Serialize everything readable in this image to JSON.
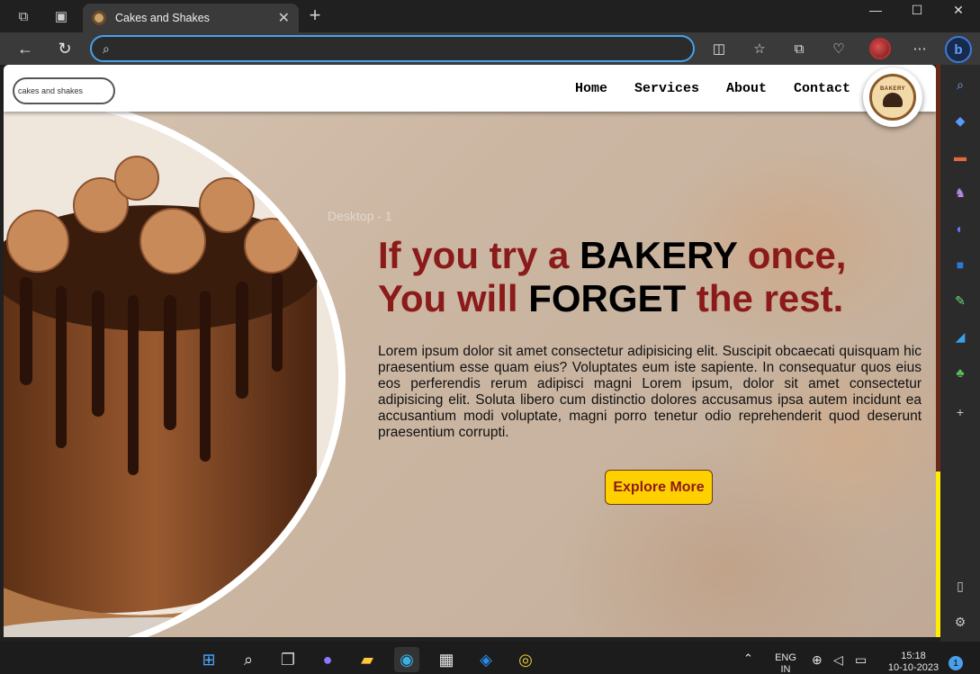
{
  "browser": {
    "tab_title": "Cakes and Shakes",
    "address_value": "",
    "window_controls": [
      "minimize-icon",
      "maximize-icon",
      "close-icon"
    ],
    "toolbar_icons": [
      "split-screen-icon",
      "favorites-icon",
      "collections-icon",
      "health-icon",
      "profile-avatar",
      "more-icon",
      "bing-icon"
    ],
    "sidebar_icons": [
      "search-icon",
      "shopping-icon",
      "tools-icon",
      "games-icon",
      "copilot-icon",
      "outlook-icon",
      "designer-icon",
      "drop-icon",
      "tree-icon",
      "add-icon",
      "panel-icon",
      "settings-icon"
    ]
  },
  "site": {
    "search_value": "cakes and shakes",
    "nav": [
      "Home",
      "Services",
      "About",
      "Contact"
    ],
    "logo_text": "BAKERY",
    "headline": {
      "line1_a": "If you try a ",
      "line1_b": "BAKERY",
      "line1_c": " once,",
      "line2_a": "You will ",
      "line2_b": "FORGET",
      "line2_c": " the rest."
    },
    "body_text": "Lorem ipsum dolor sit amet consectetur adipisicing elit. Suscipit obcaecati quisquam hic praesentium esse quam eius? Voluptates eum iste sapiente. In consequatur quos eius eos perferendis rerum adipisci magni Lorem ipsum, dolor sit amet consectetur adipisicing elit. Soluta libero cum distinctio dolores accusamus ipsa autem incidunt ea accusantium modi voluptate, magni porro tenetur odio reprehenderit quod deserunt praesentium corrupti.",
    "cta_label": "Explore More",
    "watermark": "Desktop - 1",
    "colors": {
      "accent": "#8b1a1a",
      "button": "#ffd000",
      "scroll_thumb": "#6a2a1a",
      "scroll_track": "#ffee00"
    }
  },
  "taskbar": {
    "language": "ENG",
    "region": "IN",
    "time": "15:18",
    "date": "10-10-2023",
    "notifications": "1",
    "apps": [
      "windows-start-icon",
      "search-icon",
      "task-view-icon",
      "teams-icon",
      "file-explorer-icon",
      "edge-icon",
      "store-icon",
      "vscode-icon",
      "chrome-icon"
    ]
  }
}
